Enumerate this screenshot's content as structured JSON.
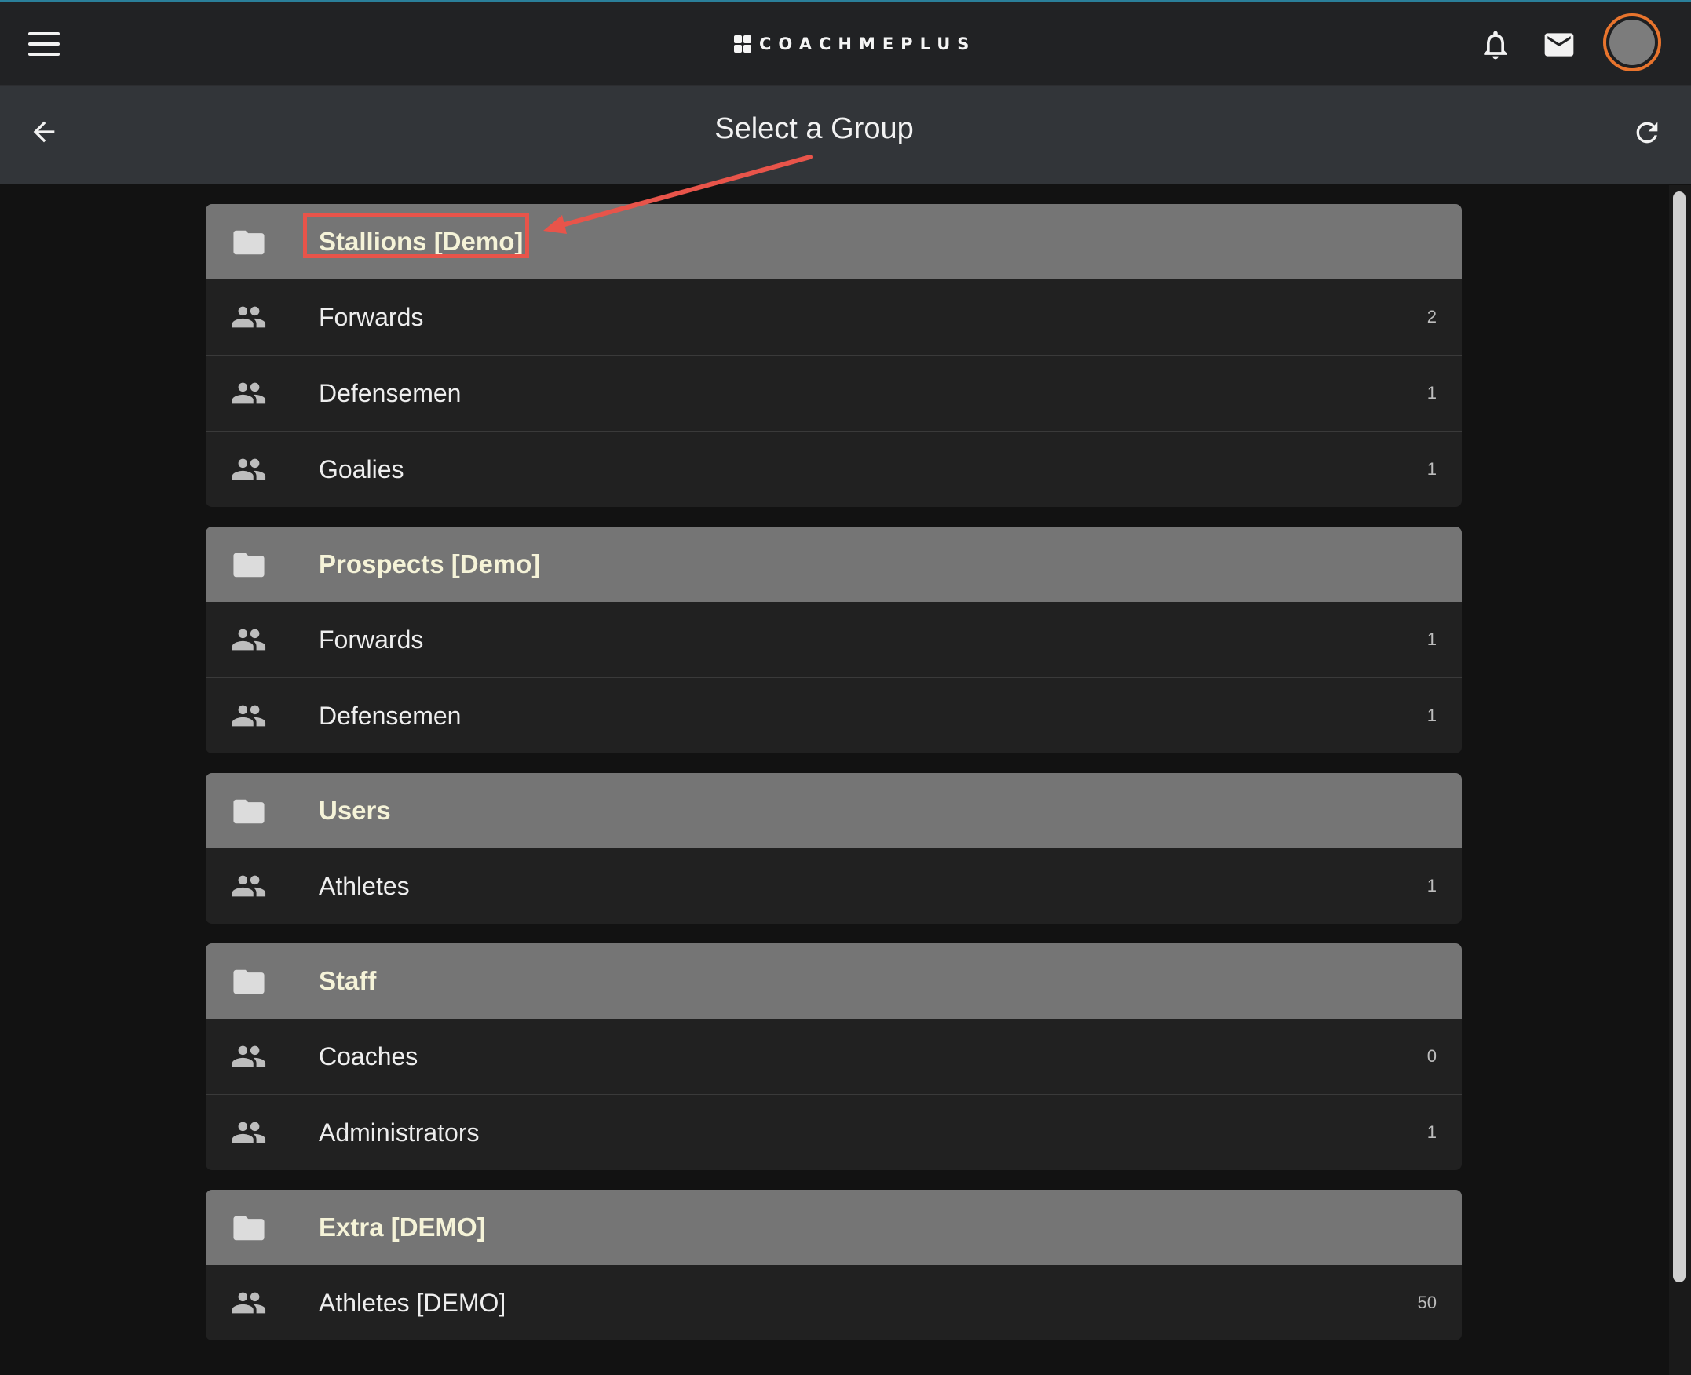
{
  "app": {
    "brand": "COACHMEPLUS"
  },
  "header": {
    "title": "Select a Group"
  },
  "groups": [
    {
      "name": "Stallions [Demo]",
      "items": [
        {
          "label": "Forwards",
          "count": "2"
        },
        {
          "label": "Defensemen",
          "count": "1"
        },
        {
          "label": "Goalies",
          "count": "1"
        }
      ]
    },
    {
      "name": "Prospects [Demo]",
      "items": [
        {
          "label": "Forwards",
          "count": "1"
        },
        {
          "label": "Defensemen",
          "count": "1"
        }
      ]
    },
    {
      "name": "Users",
      "items": [
        {
          "label": "Athletes",
          "count": "1"
        }
      ]
    },
    {
      "name": "Staff",
      "items": [
        {
          "label": "Coaches",
          "count": "0"
        },
        {
          "label": "Administrators",
          "count": "1"
        }
      ]
    },
    {
      "name": "Extra [DEMO]",
      "items": [
        {
          "label": "Athletes [DEMO]",
          "count": "50"
        }
      ]
    }
  ],
  "icons": {
    "menu": "menu-icon",
    "bell": "bell-icon",
    "mail": "mail-icon",
    "back": "arrow-left-icon",
    "refresh": "refresh-icon",
    "folder": "folder-icon",
    "group": "people-icon"
  },
  "colors": {
    "avatar_ring": "#e8742d",
    "annotation": "#e8544a",
    "group_header": "#757575"
  }
}
